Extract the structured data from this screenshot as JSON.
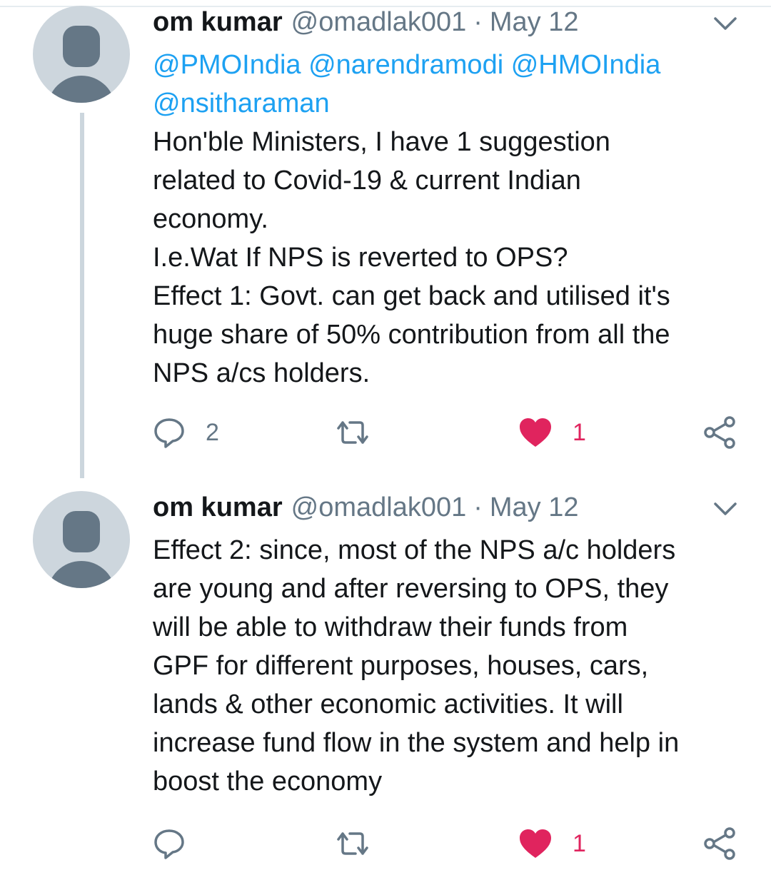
{
  "tweets": [
    {
      "author_name": "om kumar",
      "author_handle": "@omadlak001",
      "separator": "·",
      "date": "May 12",
      "lines": [
        "@PMOIndia @narendramodi @HMOIndia",
        "@nsitharaman",
        "Hon'ble Ministers, I have 1 suggestion",
        "related to Covid-19 & current Indian",
        "economy.",
        "I.e.Wat If NPS is reverted to OPS?",
        "Effect 1: Govt. can get back and utilised it's",
        "huge share of 50% contribution from all the",
        "NPS a/cs holders."
      ],
      "reply_count": "2",
      "retweet_count": "",
      "like_count": "1",
      "liked": true
    },
    {
      "author_name": "om kumar",
      "author_handle": "@omadlak001",
      "separator": "·",
      "date": "May 12",
      "lines": [
        "Effect 2: since, most of the NPS a/c holders",
        "are young and after reversing to OPS, they",
        "will be able to withdraw their funds from",
        "GPF for different purposes, houses, cars,",
        "lands & other economic activities. It will",
        "increase fund flow in the system and help in",
        "boost the economy"
      ],
      "reply_count": "",
      "retweet_count": "",
      "like_count": "1",
      "liked": true
    }
  ],
  "colors": {
    "mention": "#1da1f2",
    "like": "#e0245e",
    "secondary_text": "#657786",
    "thread_line": "#ccd6dd"
  },
  "icons": [
    "reply-icon",
    "retweet-icon",
    "heart-icon",
    "share-icon",
    "chevron-down-icon"
  ]
}
